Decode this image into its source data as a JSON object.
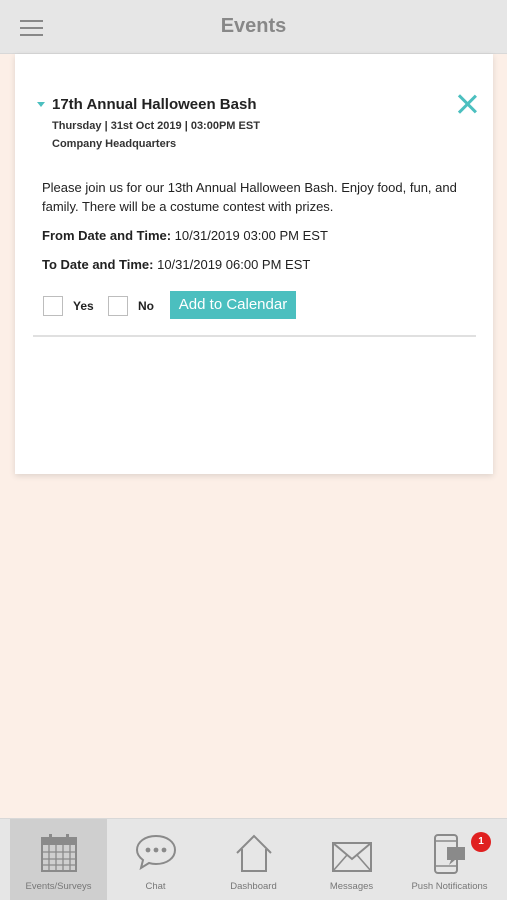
{
  "header": {
    "title": "Events",
    "menu_icon": "hamburger-icon"
  },
  "event": {
    "title": "17th Annual Halloween Bash",
    "meta": "Thursday | 31st Oct 2019 | 03:00PM EST",
    "location": "Company Headquarters",
    "description": "Please join us for our 13th Annual Halloween Bash. Enjoy food, fun, and family. There will be a costume contest with prizes.",
    "from_label": "From Date and Time:",
    "from_value": " 10/31/2019 03:00 PM EST",
    "to_label": "To Date and Time:",
    "to_value": " 10/31/2019 06:00 PM EST",
    "yes_label": "Yes",
    "no_label": "No",
    "add_to_calendar_label": "Add to Calendar"
  },
  "tabs": [
    {
      "label": "Events/Surveys",
      "icon": "calendar-icon",
      "active": true
    },
    {
      "label": "Chat",
      "icon": "chat-bubble-icon",
      "active": false
    },
    {
      "label": "Dashboard",
      "icon": "home-icon",
      "active": false
    },
    {
      "label": "Messages",
      "icon": "envelope-icon",
      "active": false
    },
    {
      "label": "Push Notifications",
      "icon": "phone-notification-icon",
      "active": false,
      "badge": "1"
    }
  ],
  "colors": {
    "accent": "#4bbfbf",
    "background": "#fcefe7",
    "badge": "#e02020"
  }
}
